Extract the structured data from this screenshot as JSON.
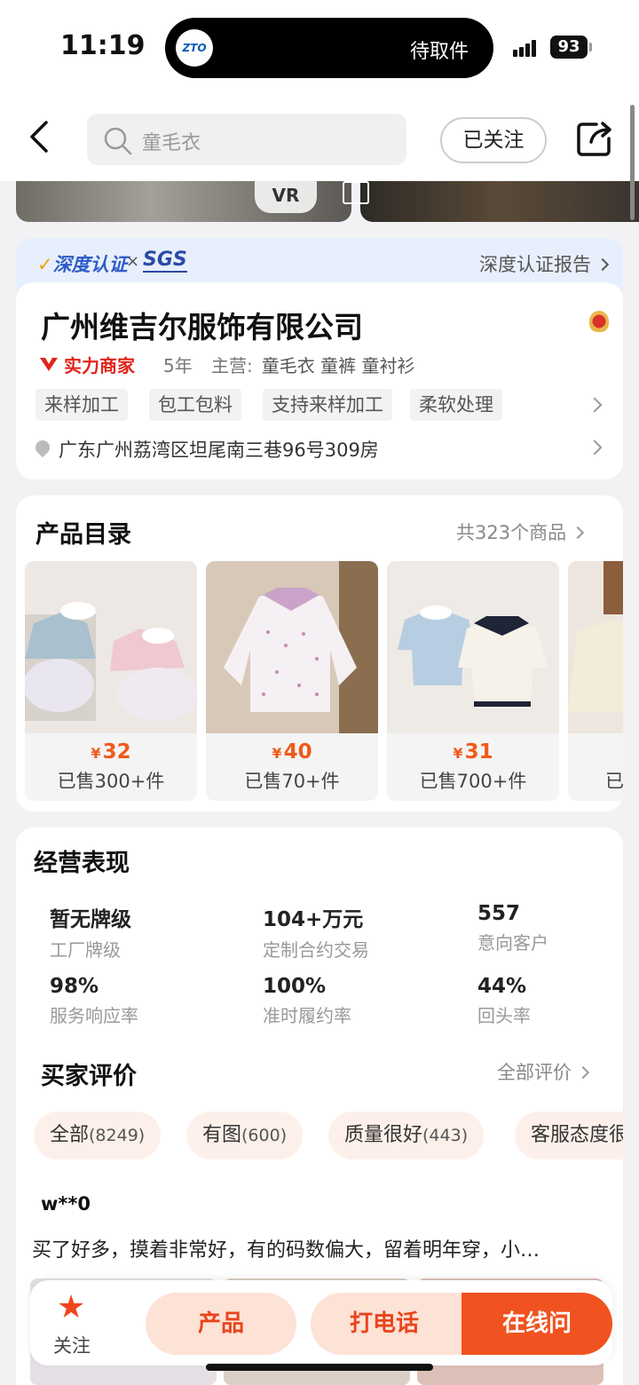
{
  "status_bar": {
    "time": "11:19",
    "courier_logo": "ZTO",
    "live_activity": "待取件",
    "battery": "93"
  },
  "nav": {
    "search_placeholder": "童毛衣",
    "follow_label": "已关注"
  },
  "hero": {
    "vr_label": "VR"
  },
  "cert": {
    "brand": "深度认证",
    "x": "×",
    "partner": "SGS",
    "report_link": "深度认证报告"
  },
  "company": {
    "name": "广州维吉尔服饰有限公司",
    "seller_type": "实力商家",
    "years": "5年",
    "main_label": "主营:",
    "main_products": "童毛衣 童裤 童衬衫",
    "tags": [
      "来样加工",
      "包工包料",
      "支持来样加工",
      "柔软处理"
    ],
    "address": "广东广州荔湾区坦尾南三巷96号309房"
  },
  "catalog": {
    "title": "产品目录",
    "total": "共323个商品",
    "products": [
      {
        "price_symbol": "¥",
        "price": "32",
        "sold": "已售300+件"
      },
      {
        "price_symbol": "¥",
        "price": "40",
        "sold": "已售70+件"
      },
      {
        "price_symbol": "¥",
        "price": "31",
        "sold": "已售700+件"
      },
      {
        "sold": "已"
      }
    ]
  },
  "performance": {
    "title": "经营表现",
    "stats": [
      {
        "value": "暂无牌级",
        "label": "工厂牌级"
      },
      {
        "value": "104+万元",
        "label": "定制合约交易"
      },
      {
        "value": "557",
        "label": "意向客户"
      },
      {
        "value": "98%",
        "label": "服务响应率"
      },
      {
        "value": "100%",
        "label": "准时履约率"
      },
      {
        "value": "44%",
        "label": "回头率"
      }
    ]
  },
  "reviews": {
    "title": "买家评价",
    "all_link": "全部评价",
    "filters": [
      {
        "label": "全部",
        "count": "(8249)"
      },
      {
        "label": "有图",
        "count": "(600)"
      },
      {
        "label": "质量很好",
        "count": "(443)"
      },
      {
        "label": "客服态度很",
        "count": ""
      }
    ],
    "reviewer": "w**0",
    "text": "买了好多，摸着非常好，有的码数偏大，留着明年穿，小…"
  },
  "bottom_bar": {
    "follow_label": "关注",
    "product_label": "产品",
    "call_label": "打电话",
    "online_label": "在线问"
  }
}
